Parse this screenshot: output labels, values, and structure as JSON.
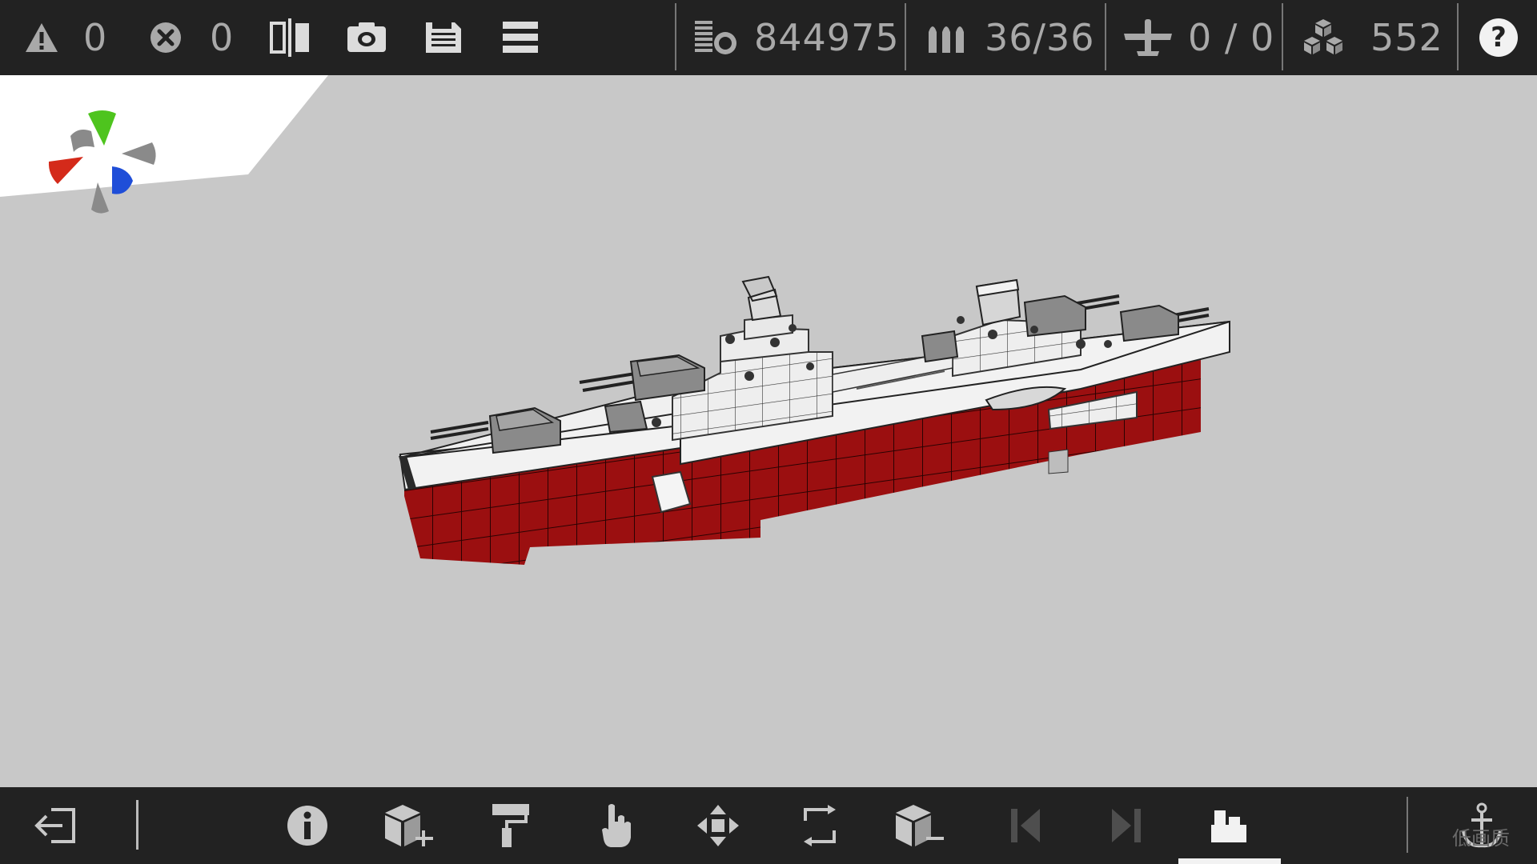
{
  "topbar": {
    "warnings": "0",
    "errors": "0",
    "cost": "844975",
    "ammo": "36/36",
    "aircraft": "0 / 0",
    "parts": "552",
    "help_label": "?"
  },
  "icons": {
    "warning": "warning-icon",
    "error": "error-icon",
    "mirror": "mirror-icon",
    "camera": "camera-icon",
    "save": "save-icon",
    "menu": "menu-icon",
    "cost": "cost-icon",
    "ammo": "ammo-icon",
    "aircraft": "aircraft-icon",
    "parts": "parts-icon"
  },
  "toolbar": {
    "items": [
      "exit",
      "info",
      "add-block",
      "paint",
      "select",
      "move",
      "rotate",
      "remove-block",
      "previous",
      "next",
      "weapons",
      "anchor"
    ]
  },
  "watermark": "低画质",
  "colors": {
    "bar": "#222222",
    "viewport": "#c8c8c8",
    "hull": "#9a0f0f",
    "axis_x": "#d42a1a",
    "axis_y": "#4ec41e",
    "axis_z": "#1f4ed8"
  }
}
